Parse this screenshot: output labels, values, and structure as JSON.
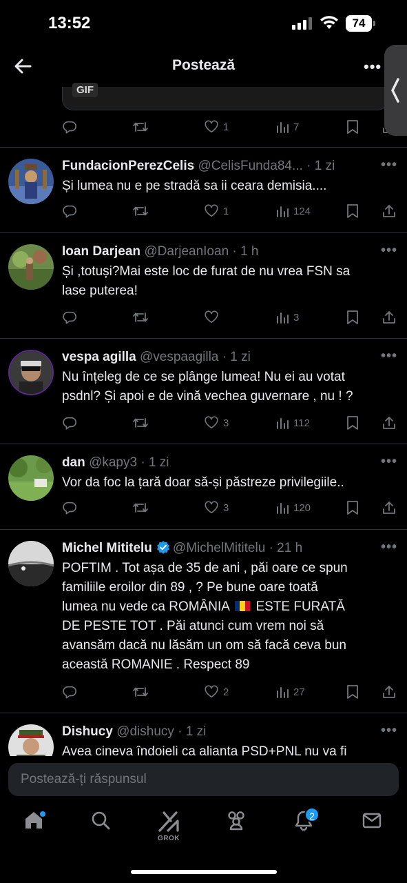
{
  "status_bar": {
    "time": "13:52",
    "battery": "74"
  },
  "header": {
    "title": "Postează",
    "more": "•••"
  },
  "prev_post": {
    "gif_label": "GIF",
    "likes": "1",
    "views": "7"
  },
  "tweets": [
    {
      "name": "FundacionPerezCelis",
      "handle": "@CelisFunda84...",
      "dot": "·",
      "time": "1 zi",
      "lines": [
        "Și lumea nu e pe stradă sa ii ceara demisia...."
      ],
      "replies": "",
      "retweets": "",
      "likes": "1",
      "views": "124"
    },
    {
      "name": "Ioan Darjean",
      "handle": "@DarjeanIoan",
      "dot": "·",
      "time": "1 h",
      "lines": [
        "Și ,totuși?Mai este loc de furat de nu vrea FSN sa",
        "lase puterea!"
      ],
      "replies": "",
      "retweets": "",
      "likes": "",
      "views": "3"
    },
    {
      "name": "vespa agilla",
      "handle": "@vespaagilla",
      "dot": "·",
      "time": "1 zi",
      "lines": [
        "Nu înțeleg de ce se plânge lumea! Nu ei au votat",
        "psdnl? Și apoi e de vină vechea guvernare , nu ! ?"
      ],
      "replies": "",
      "retweets": "",
      "likes": "3",
      "views": "112"
    },
    {
      "name": "dan",
      "handle": "@kapy3",
      "dot": "·",
      "time": "1 zi",
      "lines": [
        "Vor da foc la țară doar să-și păstreze privilegiile.."
      ],
      "replies": "",
      "retweets": "",
      "likes": "3",
      "views": "120"
    },
    {
      "name": "Michel Mititelu",
      "handle": "@MichelMititelu",
      "dot": "·",
      "time": "21 h",
      "lines": [
        "POFTIM . Tot așa de 35 de ani , păi oare ce spun",
        "familiile eroilor din 89 , ? Pe bune oare toată",
        "lumea nu vede ca ROMÂNIA",
        "ESTE FURATĂ",
        "DE PESTE TOT . Păi atunci cum vrem noi să",
        "avansăm dacă nu lăsăm un om să facă ceva bun",
        "această ROMANIE . Respect 89"
      ],
      "replies": "",
      "retweets": "",
      "likes": "2",
      "views": "27"
    },
    {
      "name": "Dishucy",
      "handle": "@dishucy",
      "dot": "·",
      "time": "1 zi",
      "lines": [
        "Avea cineva îndoieli ca alianta PSD+PNL nu va fi"
      ]
    }
  ],
  "reply_bar": {
    "placeholder": "Postează-ți răspunsul"
  },
  "tabbar": {
    "grok_label": "GROK",
    "notifications_count": "2"
  },
  "colors": {
    "accent": "#1d9bf0",
    "muted": "#71767b",
    "text": "#e7e9ea",
    "divider": "#2f3336"
  }
}
